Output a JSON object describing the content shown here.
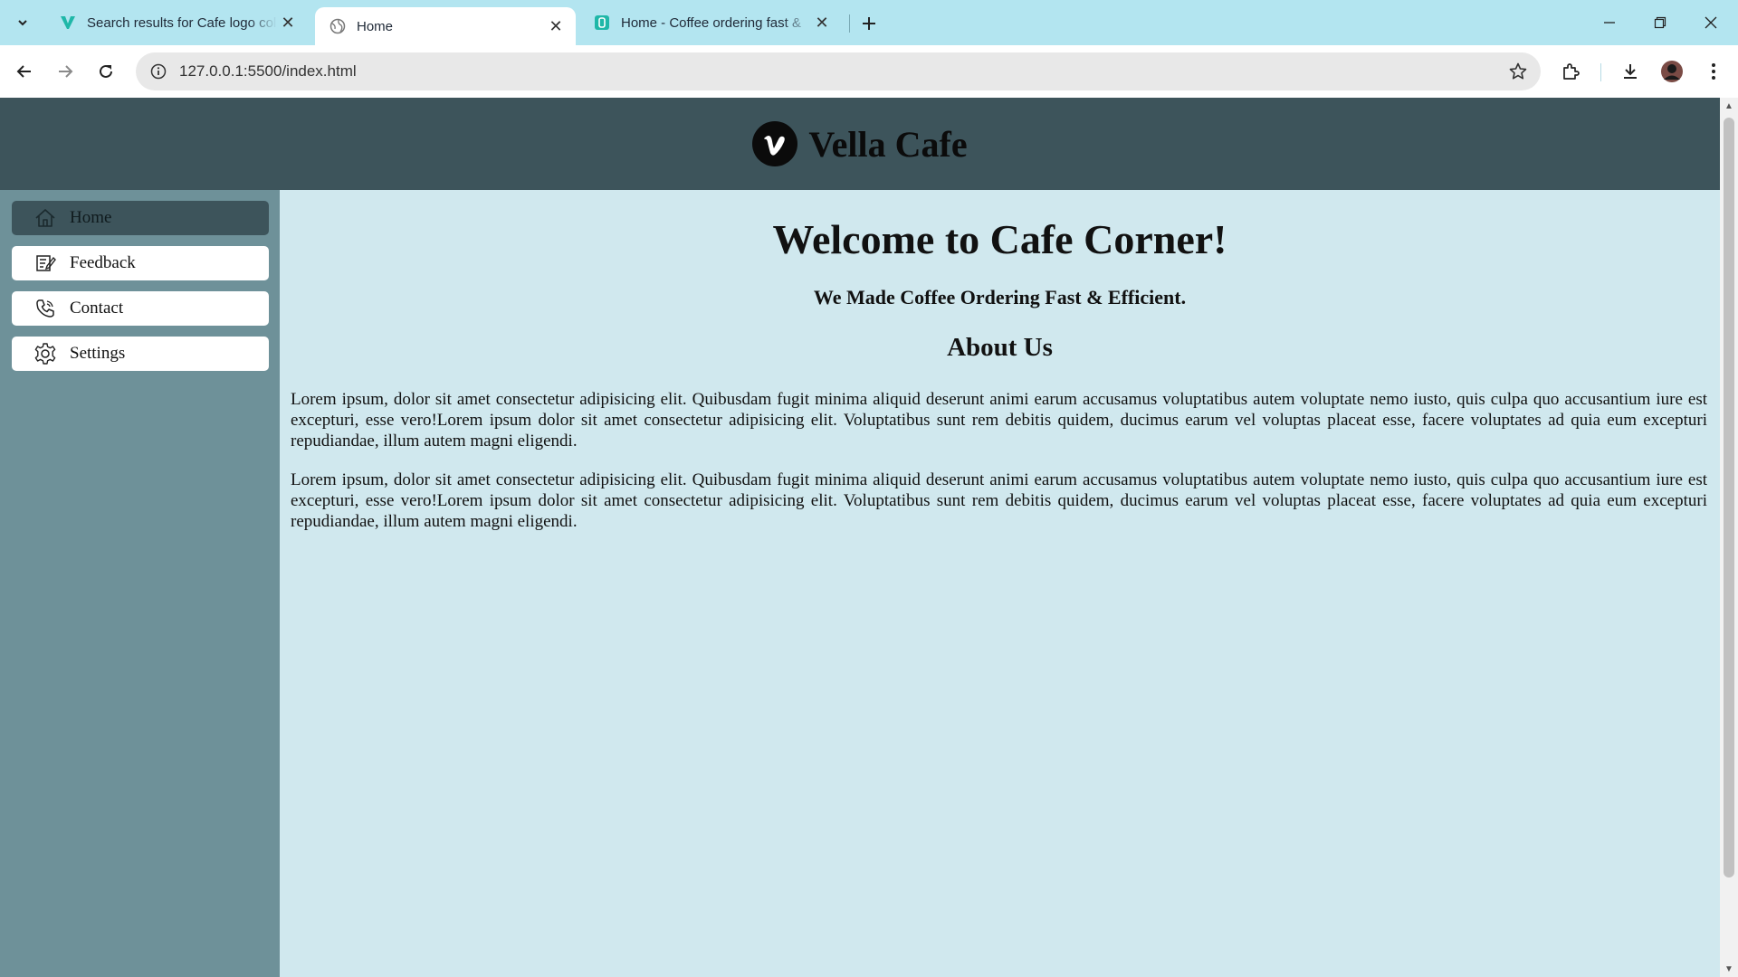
{
  "browser": {
    "tabs": [
      {
        "title": "Search results for Cafe logo col",
        "active": false
      },
      {
        "title": "Home",
        "active": true
      },
      {
        "title": "Home - Coffee ordering fast &",
        "active": false
      }
    ],
    "url": "127.0.0.1:5500/index.html"
  },
  "site": {
    "brand_name": "Vella Cafe",
    "logo_letter": "v"
  },
  "sidebar": {
    "items": [
      {
        "label": "Home",
        "icon": "home-icon",
        "active": true
      },
      {
        "label": "Feedback",
        "icon": "feedback-icon",
        "active": false
      },
      {
        "label": "Contact",
        "icon": "phone-icon",
        "active": false
      },
      {
        "label": "Settings",
        "icon": "gear-icon",
        "active": false
      }
    ]
  },
  "main": {
    "heading": "Welcome to Cafe Corner!",
    "tagline": "We Made Coffee Ordering Fast & Efficient.",
    "about_heading": "About Us",
    "paragraphs": [
      "Lorem ipsum, dolor sit amet consectetur adipisicing elit. Quibusdam fugit minima aliquid deserunt animi earum accusamus voluptatibus autem voluptate nemo iusto, quis culpa quo accusantium iure est excepturi, esse vero!Lorem ipsum dolor sit amet consectetur adipisicing elit. Voluptatibus sunt rem debitis quidem, ducimus earum vel voluptas placeat esse, facere voluptates ad quia eum excepturi repudiandae, illum autem magni eligendi.",
      "Lorem ipsum, dolor sit amet consectetur adipisicing elit. Quibusdam fugit minima aliquid deserunt animi earum accusamus voluptatibus autem voluptate nemo iusto, quis culpa quo accusantium iure est excepturi, esse vero!Lorem ipsum dolor sit amet consectetur adipisicing elit. Voluptatibus sunt rem debitis quidem, ducimus earum vel voluptas placeat esse, facere voluptates ad quia eum excepturi repudiandae, illum autem magni eligendi."
    ]
  },
  "colors": {
    "tabbar_bg": "#b3e5f0",
    "header_bg": "#3d545b",
    "sidebar_bg": "#6e9199",
    "content_bg": "#d0e8ee"
  }
}
